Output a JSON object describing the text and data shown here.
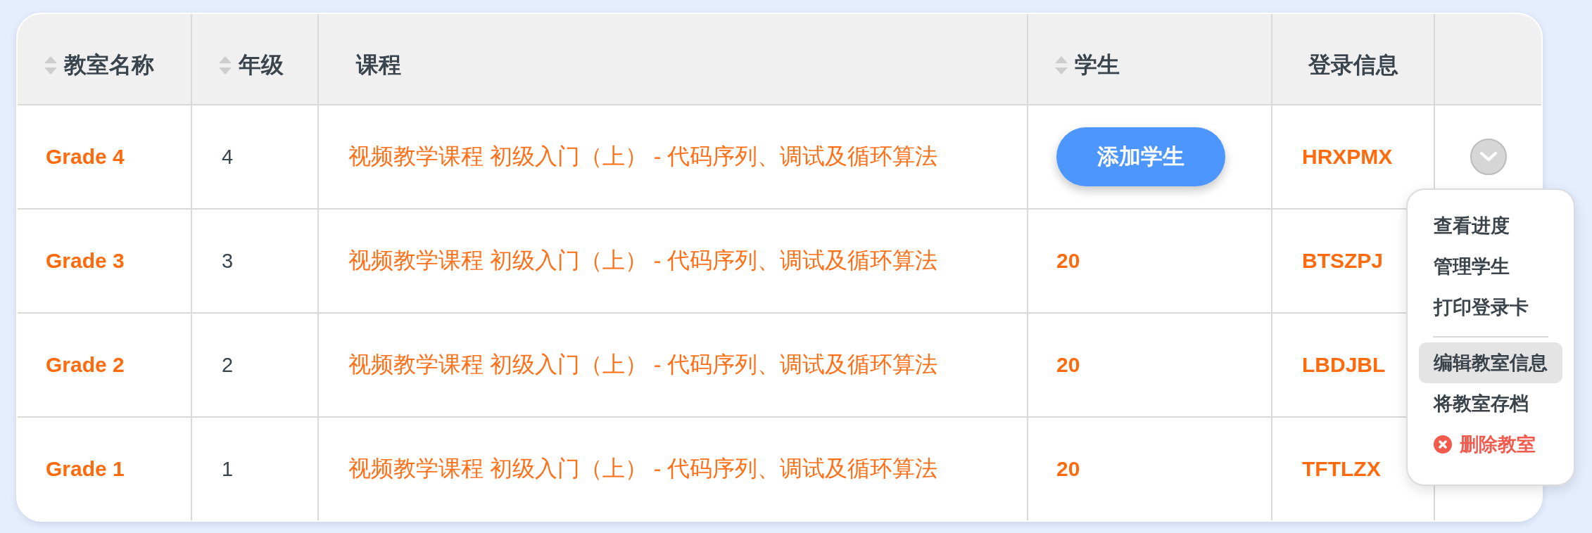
{
  "table": {
    "columns": [
      {
        "title": "教室名称",
        "sortable": true
      },
      {
        "title": "年级",
        "sortable": true
      },
      {
        "title": "课程",
        "sortable": false
      },
      {
        "title": "学生",
        "sortable": true
      },
      {
        "title": "登录信息",
        "sortable": false
      }
    ],
    "rows": [
      {
        "name": "Grade 4",
        "grade": "4",
        "course": "视频教学课程 初级入门（上） - 代码序列、调试及循环算法",
        "students": {
          "kind": "button",
          "text": "添加学生"
        },
        "login_code": "HRXPMX",
        "menu": {
          "expanded": true,
          "items": [
            {
              "kind": "action",
              "label": "查看进度",
              "selected": false
            },
            {
              "kind": "action",
              "label": "管理学生",
              "selected": false
            },
            {
              "kind": "action",
              "label": "打印登录卡",
              "selected": false
            },
            {
              "kind": "divider"
            },
            {
              "kind": "action",
              "label": "编辑教室信息",
              "selected": true
            },
            {
              "kind": "action",
              "label": "将教室存档",
              "selected": false
            },
            {
              "kind": "danger",
              "label": "删除教室",
              "selected": false
            }
          ]
        }
      },
      {
        "name": "Grade 3",
        "grade": "3",
        "course": "视频教学课程 初级入门（上） - 代码序列、调试及循环算法",
        "students": {
          "kind": "count",
          "text": "20"
        },
        "login_code": "BTSZPJ"
      },
      {
        "name": "Grade 2",
        "grade": "2",
        "course": "视频教学课程 初级入门（上） - 代码序列、调试及循环算法",
        "students": {
          "kind": "count",
          "text": "20"
        },
        "login_code": "LBDJBL"
      },
      {
        "name": "Grade 1",
        "grade": "1",
        "course": "视频教学课程 初级入门（上） - 代码序列、调试及循环算法",
        "students": {
          "kind": "count",
          "text": "20"
        },
        "login_code": "TFTLZX"
      }
    ]
  }
}
